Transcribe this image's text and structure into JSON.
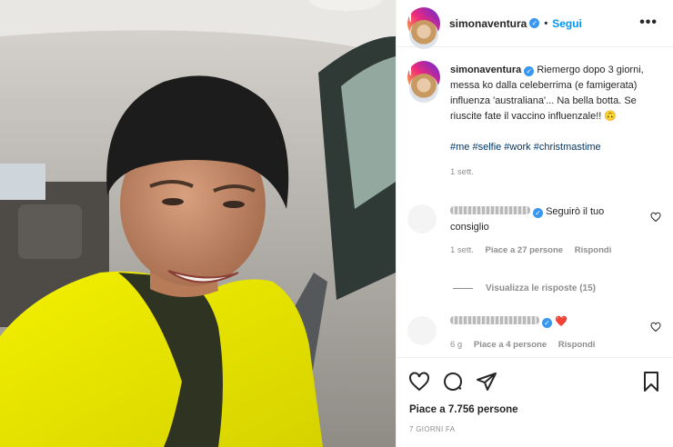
{
  "header": {
    "username": "simonaventura",
    "separator": "•",
    "follow_label": "Segui",
    "more_icon": "more-options-icon"
  },
  "caption": {
    "username": "simonaventura",
    "text": "Riemergo dopo 3 giorni, messa ko dalla celeberrima (e famigerata) influenza 'australiana'... Na bella botta. Se riuscite fate il vaccino influenzale!! 🙃",
    "hashtags": "#me #selfie #work #christmastime",
    "time": "1 sett."
  },
  "comments": [
    {
      "text": "Seguirò il tuo consiglio",
      "time": "1 sett.",
      "likes": "Piace a 27 persone",
      "reply": "Rispondi"
    },
    {
      "text": "❤️",
      "time": "6 g",
      "likes": "Piace a 4 persone",
      "reply": "Rispondi"
    }
  ],
  "view_replies": "Visualizza le risposte (15)",
  "likes_text": "Piace a 7.756 persone",
  "posted_ago": "7 GIORNI FA",
  "colors": {
    "accent": "#0095f6",
    "verified": "#3897f0",
    "hashtag": "#00376b",
    "muted": "#8e8e8e",
    "heart": "#ed4956"
  }
}
